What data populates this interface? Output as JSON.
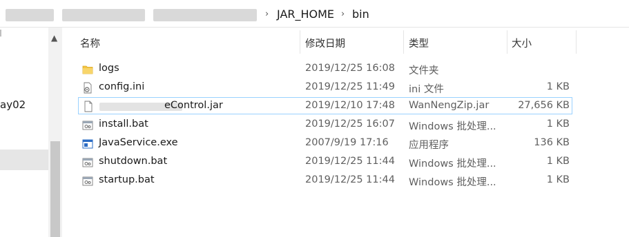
{
  "address": {
    "crumbs": [
      "JAR_HOME",
      "bin"
    ],
    "separator": "›"
  },
  "nav": {
    "partial_label": "ay02"
  },
  "columns": {
    "name": "名称",
    "modified": "修改日期",
    "type": "类型",
    "size": "大小"
  },
  "files": [
    {
      "name": "logs",
      "modified": "2019/12/25 16:08",
      "type": "文件夹",
      "size": "",
      "icon": "folder-icon"
    },
    {
      "name": "config.ini",
      "modified": "2019/12/25 11:49",
      "type": "ini 文件",
      "size": "1 KB",
      "icon": "ini-file-icon"
    },
    {
      "name": "eControl.jar",
      "modified": "2019/12/10 17:48",
      "type": "WanNengZip.jar",
      "size": "27,656 KB",
      "icon": "jar-file-icon"
    },
    {
      "name": "install.bat",
      "modified": "2019/12/25 16:07",
      "type": "Windows 批处理...",
      "size": "1 KB",
      "icon": "bat-file-icon"
    },
    {
      "name": "JavaService.exe",
      "modified": "2007/9/19 17:16",
      "type": "应用程序",
      "size": "136 KB",
      "icon": "exe-file-icon"
    },
    {
      "name": "shutdown.bat",
      "modified": "2019/12/25 11:44",
      "type": "Windows 批处理...",
      "size": "1 KB",
      "icon": "bat-file-icon"
    },
    {
      "name": "startup.bat",
      "modified": "2019/12/25 11:44",
      "type": "Windows 批处理...",
      "size": "1 KB",
      "icon": "bat-file-icon"
    }
  ],
  "colors": {
    "selection_border": "#99d1ff",
    "folder": "#f4c542",
    "exe_blue": "#2b6cc4"
  }
}
